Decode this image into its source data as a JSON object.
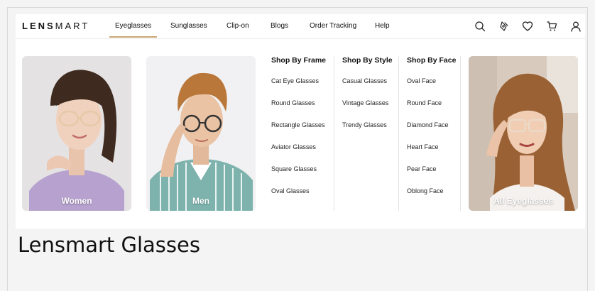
{
  "brand": {
    "bold": "LENS",
    "light": "MART"
  },
  "nav": {
    "items": [
      {
        "label": "Eyeglasses",
        "active": true
      },
      {
        "label": "Sunglasses",
        "active": false
      },
      {
        "label": "Clip-on",
        "active": false
      },
      {
        "label": "Blogs",
        "active": false
      },
      {
        "label": "Order Tracking",
        "active": false
      },
      {
        "label": "Help",
        "active": false
      }
    ],
    "accent_color": "#c9a772"
  },
  "icons": [
    "search-icon",
    "try-on-icon",
    "heart-icon",
    "cart-icon",
    "user-icon"
  ],
  "promo": {
    "women": "Women",
    "men": "Men",
    "all": "All Eyeglasses"
  },
  "menu": {
    "frame": {
      "title": "Shop By Frame",
      "items": [
        "Cat Eye Glasses",
        "Round Glasses",
        "Rectangle Glasses",
        "Aviator Glasses",
        "Square Glasses",
        "Oval Glasses"
      ]
    },
    "style": {
      "title": "Shop By Style",
      "items": [
        "Casual Glasses",
        "Vintage Glasses",
        "Trendy Glasses"
      ]
    },
    "face": {
      "title": "Shop By Face",
      "items": [
        "Oval Face",
        "Round Face",
        "Diamond Face",
        "Heart Face",
        "Pear Face",
        "Oblong Face"
      ]
    }
  },
  "page_heading": "Lensmart Glasses"
}
